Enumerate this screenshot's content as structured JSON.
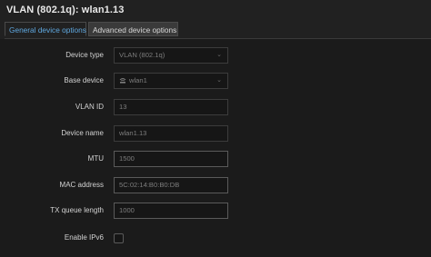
{
  "page": {
    "title": "VLAN (802.1q): wlan1.13"
  },
  "tabs": [
    {
      "label": "General device options",
      "active": true
    },
    {
      "label": "Advanced device options",
      "active": false
    }
  ],
  "form": {
    "device_type": {
      "label": "Device type",
      "value": "VLAN (802.1q)"
    },
    "base_device": {
      "label": "Base device",
      "value": "wlan1",
      "icon": "wireless-icon"
    },
    "vlan_id": {
      "label": "VLAN ID",
      "value": "13"
    },
    "device_name": {
      "label": "Device name",
      "value": "wlan1.13"
    },
    "mtu": {
      "label": "MTU",
      "value": "1500"
    },
    "mac_address": {
      "label": "MAC address",
      "value": "5C:02:14:B0:B0:DB"
    },
    "tx_queue_length": {
      "label": "TX queue length",
      "value": "1000"
    },
    "enable_ipv6": {
      "label": "Enable IPv6",
      "checked": false
    }
  },
  "colors": {
    "accent": "#5fa8e0",
    "background": "#212121"
  }
}
